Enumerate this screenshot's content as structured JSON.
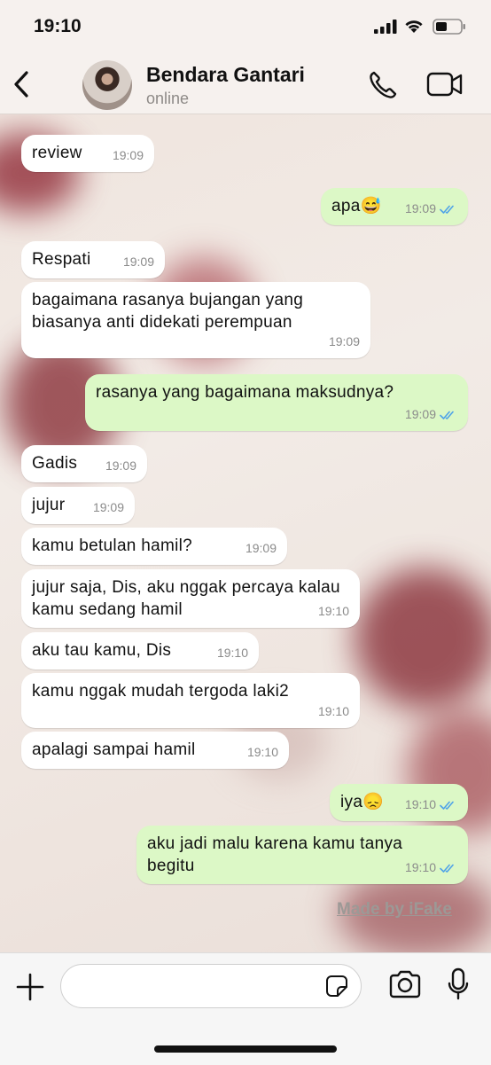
{
  "status": {
    "time": "19:10"
  },
  "header": {
    "contact_name": "Bendara Gantari",
    "contact_status": "online"
  },
  "messages": [
    {
      "dir": "in",
      "text": "review",
      "time": "19:09"
    },
    {
      "dir": "out",
      "text": "apa😅",
      "time": "19:09",
      "read": true
    },
    {
      "dir": "in",
      "text": "Respati",
      "time": "19:09"
    },
    {
      "dir": "in",
      "text": "bagaimana rasanya bujangan yang biasanya anti didekati perempuan",
      "time": "19:09"
    },
    {
      "dir": "out",
      "text": "rasanya yang bagaimana maksudnya?",
      "time": "19:09",
      "read": true
    },
    {
      "dir": "in",
      "text": "Gadis",
      "time": "19:09"
    },
    {
      "dir": "in",
      "text": "jujur",
      "time": "19:09"
    },
    {
      "dir": "in",
      "text": "kamu betulan hamil?",
      "time": "19:09"
    },
    {
      "dir": "in",
      "text": "jujur saja, Dis, aku nggak percaya kalau kamu sedang hamil",
      "time": "19:10"
    },
    {
      "dir": "in",
      "text": "aku tau kamu, Dis",
      "time": "19:10"
    },
    {
      "dir": "in",
      "text": "kamu nggak mudah tergoda laki2",
      "time": "19:10"
    },
    {
      "dir": "in",
      "text": "apalagi sampai hamil",
      "time": "19:10"
    },
    {
      "dir": "out",
      "text": "iya😞",
      "time": "19:10",
      "read": true
    },
    {
      "dir": "out",
      "text": "aku jadi malu karena kamu tanya begitu",
      "time": "19:10",
      "read": true
    }
  ],
  "watermark": "Made by iFake",
  "composer": {
    "placeholder": ""
  },
  "icons": {
    "back": "chevron-left-icon",
    "call": "phone-icon",
    "video": "video-camera-icon",
    "plus": "plus-icon",
    "sticker": "sticker-icon",
    "camera": "camera-icon",
    "mic": "microphone-icon"
  },
  "colors": {
    "outgoing_bubble": "#dcf8c6",
    "incoming_bubble": "#ffffff",
    "read_ticks": "#4fa3e8"
  }
}
